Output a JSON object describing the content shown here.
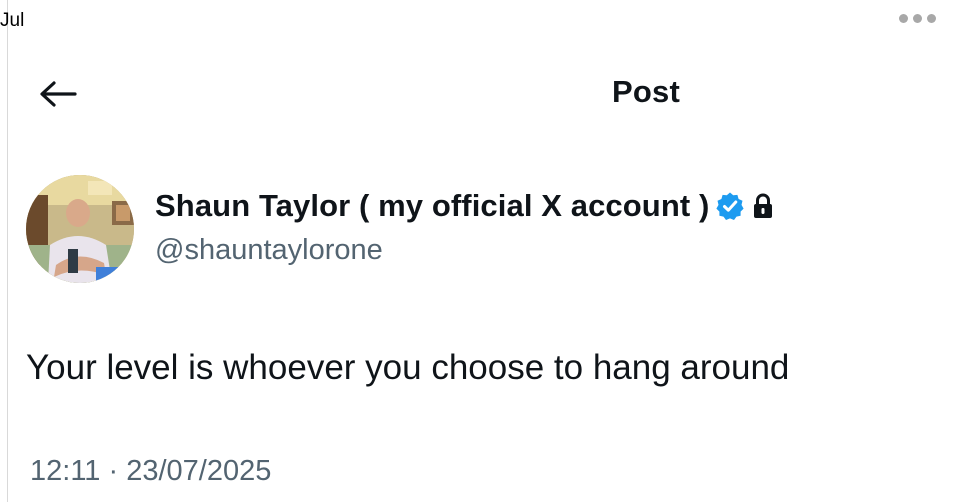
{
  "top_label": "Jul",
  "header": {
    "title": "Post",
    "back_icon": "arrow-left-icon",
    "more_icon": "more-horizontal-icon"
  },
  "author": {
    "display_name": "Shaun Taylor ( my official X account )",
    "handle": "@shauntaylorone",
    "verified_icon": "verified-badge-icon",
    "verified_color": "#1d9bf0",
    "protected_icon": "lock-icon"
  },
  "post": {
    "text": "Your level is whoever you choose to hang around",
    "timestamp": "12:11 · 23/07/2025"
  },
  "colors": {
    "text_primary": "#0f1419",
    "text_secondary": "#536471"
  }
}
